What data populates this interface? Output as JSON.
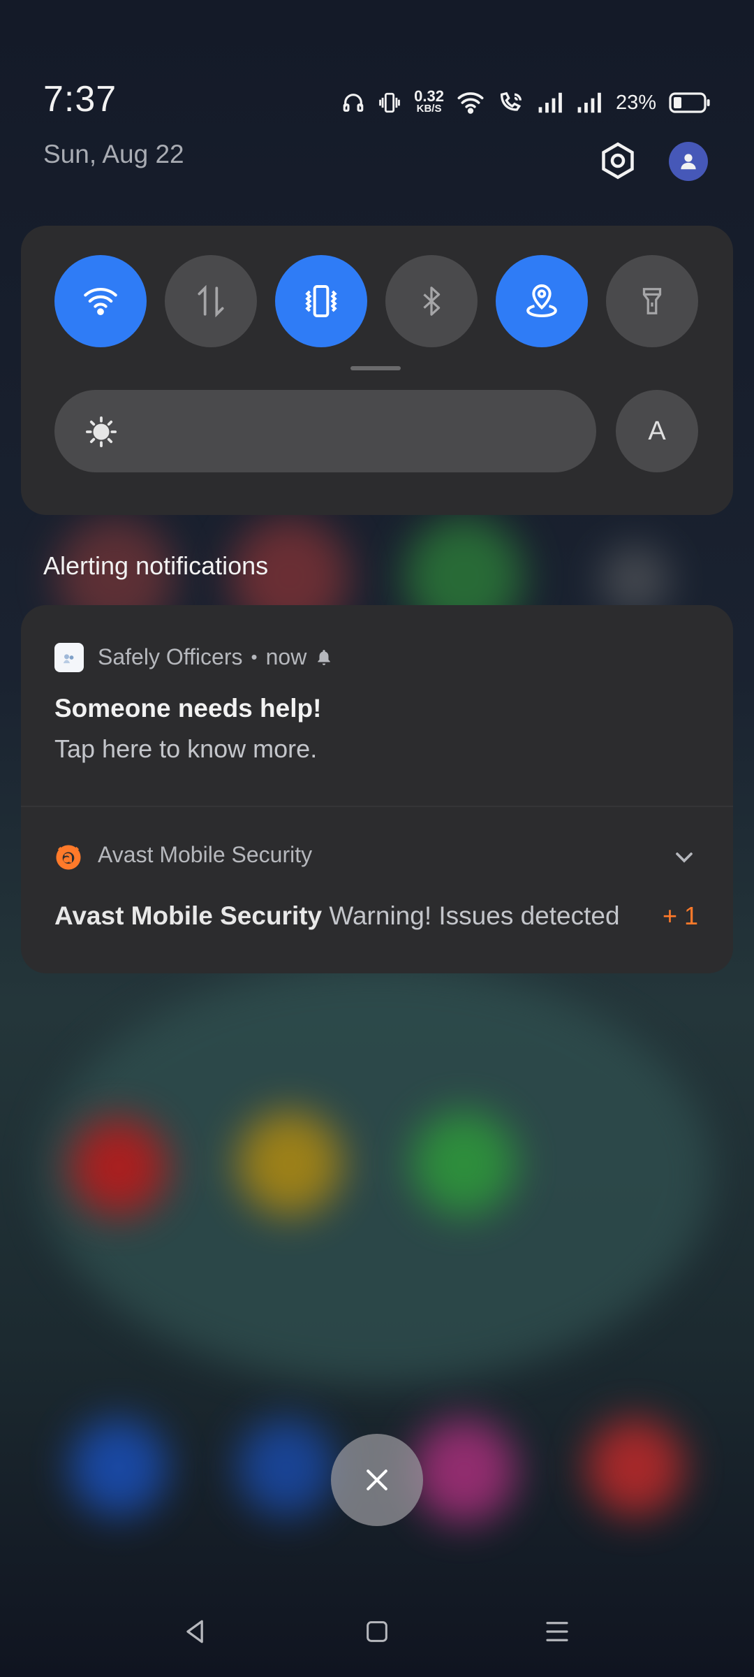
{
  "status_bar": {
    "time": "7:37",
    "date": "Sun, Aug 22",
    "network_speed_value": "0.32",
    "network_speed_unit": "KB/S",
    "battery_percent": "23%",
    "icons": [
      "headphones-icon",
      "vibrate-icon",
      "wifi-icon",
      "wifi-calling-icon",
      "signal-icon",
      "signal-icon",
      "battery-icon"
    ]
  },
  "header_actions": {
    "settings_icon": "settings-icon",
    "profile_icon": "user-icon"
  },
  "quick_settings": {
    "tiles": [
      {
        "icon": "wifi-icon",
        "state": "on"
      },
      {
        "icon": "mobile-data-icon",
        "state": "off"
      },
      {
        "icon": "vibrate-icon",
        "state": "on"
      },
      {
        "icon": "bluetooth-icon",
        "state": "off"
      },
      {
        "icon": "location-icon",
        "state": "on"
      },
      {
        "icon": "flashlight-icon",
        "state": "off"
      }
    ],
    "brightness_auto_label": "A",
    "accent_color": "#2f7cf6"
  },
  "notifications_section": {
    "label": "Alerting notifications"
  },
  "notifications": [
    {
      "app": "Safely Officers",
      "separator": "•",
      "time": "now",
      "title": "Someone needs help!",
      "body": "Tap here to know more."
    },
    {
      "app": "Avast Mobile Security",
      "summary_app": "Avast Mobile Security",
      "summary_text": "Warning! Issues detected",
      "count": "+ 1",
      "accent_color": "#ff7a2a"
    }
  ],
  "clear_all": {
    "icon": "close-icon"
  },
  "nav_bar": {
    "icons": [
      "back-icon",
      "home-icon",
      "recents-icon"
    ]
  }
}
